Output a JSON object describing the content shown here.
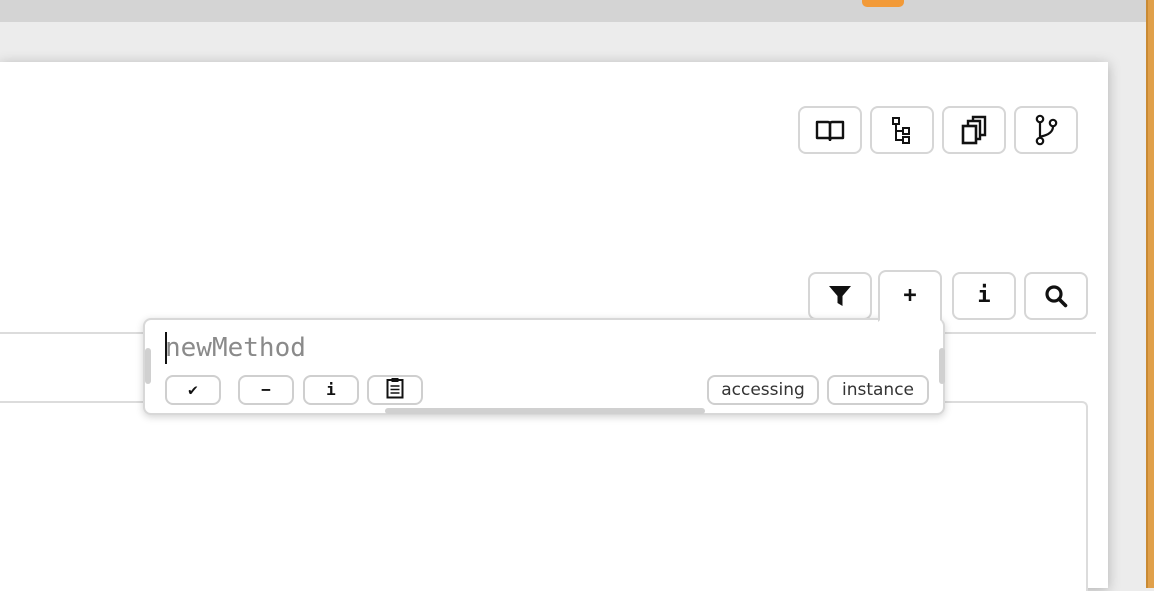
{
  "toolbar_top": {
    "buttons": [
      {
        "icon": "book-icon",
        "glyph": ""
      },
      {
        "icon": "tree-hierarchy-icon",
        "glyph": ""
      },
      {
        "icon": "copy-windows-icon",
        "glyph": ""
      },
      {
        "icon": "branch-icon",
        "glyph": ""
      }
    ]
  },
  "toolbar_methods": {
    "filter_icon": "filter-icon",
    "add_glyph": "+",
    "info_glyph": "i",
    "search_icon": "search-icon"
  },
  "new_method_popup": {
    "input_placeholder": "newMethod",
    "input_value": "",
    "accept_glyph": "✔",
    "remove_glyph": "−",
    "info_glyph": "i",
    "clipboard_icon": "clipboard-icon",
    "protocol_tag": "accessing",
    "side_tag": "instance"
  },
  "colors": {
    "accent_orange": "#f29a38",
    "border_gray": "#d6d6d6",
    "background": "#ececec"
  }
}
